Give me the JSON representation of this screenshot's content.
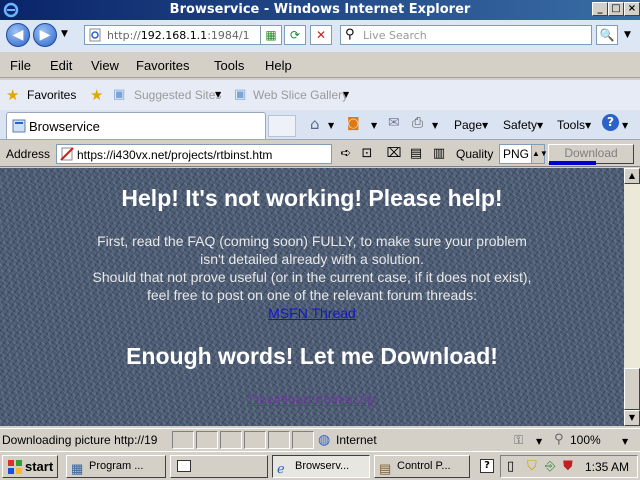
{
  "window": {
    "title": "Browservice - Windows Internet Explorer"
  },
  "nav": {
    "url_prefix": "http://",
    "url_host": "192.168.1.1",
    "url_rest": ":1984/1",
    "search_placeholder": "Live Search"
  },
  "menu": [
    "File",
    "Edit",
    "View",
    "Favorites",
    "Tools",
    "Help"
  ],
  "favorites": {
    "label": "Favorites",
    "items": [
      "Suggested Sites",
      "Web Slice Gallery"
    ]
  },
  "tab": {
    "label": "Browservice"
  },
  "commands": {
    "page": "Page",
    "safety": "Safety",
    "tools": "Tools"
  },
  "address_toolbar": {
    "label": "Address",
    "url": "https://i430vx.net/projects/rtbinst.htm",
    "quality_label": "Quality",
    "quality_value": "PNG",
    "download_label": "Download",
    "download_progress": 0.55
  },
  "content": {
    "heading1": "Help! It's not working! Please help!",
    "para1_line1": "First, read the FAQ (coming soon) FULLY, to make sure your problem",
    "para1_line2": "isn't detailed already with a solution.",
    "para2_line1": "Should that not prove useful (or in the current case, if it does not exist),",
    "para2_line2": "feel free to post on one of the relevant forum threads:",
    "link1": "MSFN Thread",
    "heading2": "Enough words! Let me Download!",
    "link2": "Download rtbinst.zip"
  },
  "status": {
    "text": "Downloading picture http://19",
    "zone": "Internet",
    "zoom": "100%"
  },
  "taskbar": {
    "start": "start",
    "tasks": [
      "Program ...",
      "",
      "Browserv...",
      "Control P..."
    ],
    "clock": "1:35 AM"
  }
}
